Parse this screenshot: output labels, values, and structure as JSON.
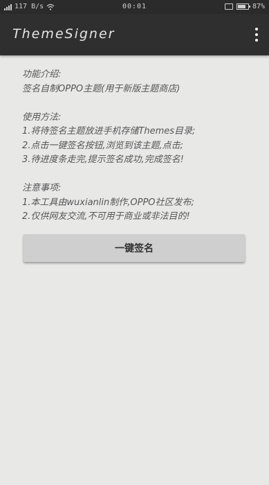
{
  "status_bar": {
    "network_speed": "117 B/s",
    "time": "00:01",
    "battery": "87%"
  },
  "app_bar": {
    "title": "ThemeSigner"
  },
  "content": {
    "intro_heading": "功能介绍:",
    "intro_text": "签名自制OPPO主题(用于新版主题商店)",
    "usage_heading": "使用方法:",
    "usage_steps": [
      "1.将待签名主题放进手机存储Themes目录;",
      "2.点击一键签名按钮,浏览到该主题,点击;",
      "3.待进度条走完,提示签名成功,完成签名!"
    ],
    "notes_heading": "注意事项:",
    "notes": [
      "1.本工具由wuxianlin制作,OPPO社区发布;",
      "2.仅供网友交流,不可用于商业或非法目的!"
    ]
  },
  "sign_button": {
    "label": "一键签名"
  }
}
